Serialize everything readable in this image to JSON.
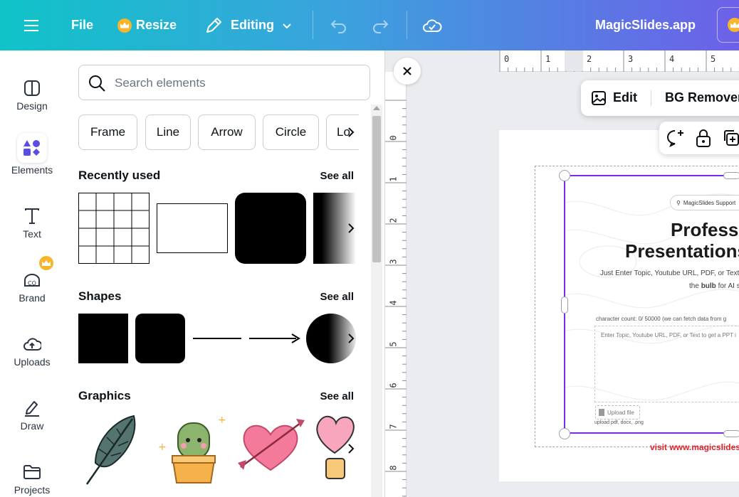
{
  "topbar": {
    "file_label": "File",
    "resize_label": "Resize",
    "editing_label": "Editing",
    "app_title": "MagicSlides.app"
  },
  "rail": {
    "items": [
      {
        "label": "Design",
        "icon": "layout-icon"
      },
      {
        "label": "Elements",
        "icon": "shapes-icon"
      },
      {
        "label": "Text",
        "icon": "text-t-icon"
      },
      {
        "label": "Brand",
        "icon": "brand-kit-icon"
      },
      {
        "label": "Uploads",
        "icon": "cloud-upload-icon"
      },
      {
        "label": "Draw",
        "icon": "pen-icon"
      },
      {
        "label": "Projects",
        "icon": "folder-icon"
      }
    ]
  },
  "panel": {
    "search_placeholder": "Search elements",
    "chips": [
      "Frame",
      "Line",
      "Arrow",
      "Circle",
      "Lo"
    ],
    "recently_used_title": "Recently used",
    "shapes_title": "Shapes",
    "graphics_title": "Graphics",
    "see_all": "See all"
  },
  "canvas": {
    "ruler_top": [
      "0",
      "1",
      "2",
      "3",
      "4",
      "5"
    ],
    "ruler_left": [
      "0",
      "1",
      "2",
      "3",
      "4",
      "5",
      "6",
      "7",
      "8"
    ],
    "edit_label": "Edit",
    "bg_remover_label": "BG Remover"
  },
  "slide": {
    "support_pill": "MagicSlides Support",
    "hero_line1": "Professio",
    "hero_line2": "Presentations",
    "sub_line1": "Just Enter Topic, Youtube URL, PDF, or Text",
    "sub_line2_pre": "the ",
    "sub_line2_bold": "bulb",
    "sub_line2_post": " for AI s",
    "char_count": "character count: 0/ 50000 (we can fetch data from g",
    "textarea_placeholder": "Enter Topic, Youtube URL, PDF, or Text to get a PPT i",
    "upload_label": "Upload file",
    "upload_types": "upload pdf, docx, .png",
    "visit_text": "visit www.magicslides."
  },
  "colors": {
    "accent_purple": "#7d2ae8",
    "topbar_start": "#10c3c8",
    "topbar_end": "#6d60e8",
    "brand_crown": "#f7b52b",
    "visit_red": "#e0202a"
  }
}
